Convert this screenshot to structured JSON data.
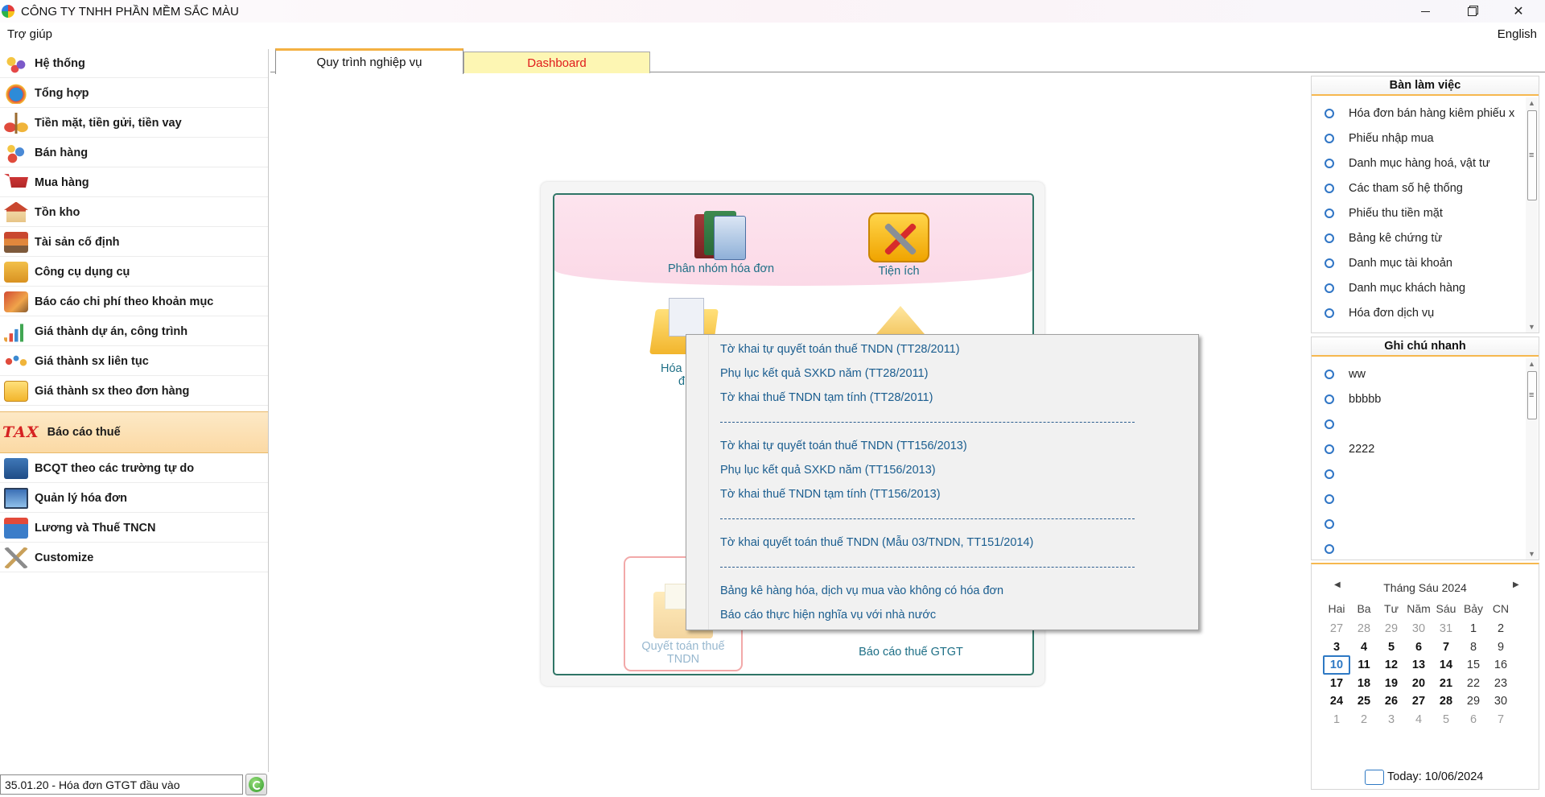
{
  "window": {
    "title": "CÔNG TY TNHH PHẦN MỀM SẮC MÀU"
  },
  "menubar": {
    "help": "Trợ giúp",
    "language": "English"
  },
  "sidebar": {
    "items": [
      {
        "label": "Hệ thống"
      },
      {
        "label": "Tổng hợp"
      },
      {
        "label": "Tiền mặt, tiền gửi, tiền vay"
      },
      {
        "label": "Bán hàng"
      },
      {
        "label": "Mua hàng"
      },
      {
        "label": "Tồn kho"
      },
      {
        "label": "Tài sản cố định"
      },
      {
        "label": "Công cụ dụng cụ"
      },
      {
        "label": "Báo cáo chi phí theo khoản mục"
      },
      {
        "label": "Giá thành dự án, công trình"
      },
      {
        "label": "Giá thành sx liên tục"
      },
      {
        "label": "Giá thành sx theo đơn hàng"
      },
      {
        "label": "Báo cáo thuế",
        "icon_text": "TAX",
        "active": true
      },
      {
        "label": "BCQT theo các trường tự do"
      },
      {
        "label": "Quản lý hóa đơn"
      },
      {
        "label": "Lương và Thuế TNCN"
      },
      {
        "label": "Customize"
      }
    ],
    "search_value": "35.01.20 - Hóa đơn GTGT đầu vào"
  },
  "tabs": [
    {
      "label": "Quy trình nghiệp vụ",
      "active": true
    },
    {
      "label": "Dashboard"
    }
  ],
  "workflow": {
    "group_invoices": "Phân nhóm hóa đơn",
    "utilities": "Tiện ích",
    "partial_left": "Hóa",
    "partial_left2": "đ",
    "cit_settlement_line1": "Quyết toán thuế",
    "cit_settlement_line2": "TNDN",
    "vat_report": "Báo cáo thuế GTGT"
  },
  "context_menu": {
    "items": [
      "Tờ khai tự quyết toán thuế TNDN (TT28/2011)",
      "Phụ lục kết quả SXKD năm (TT28/2011)",
      "Tờ khai thuế TNDN tạm tính (TT28/2011)",
      "Tờ khai tự quyết toán thuế TNDN (TT156/2013)",
      "Phụ lục kết quả SXKD năm (TT156/2013)",
      "Tờ khai thuế TNDN tạm tính (TT156/2013)",
      "Tờ khai quyết toán thuế TNDN (Mẫu 03/TNDN, TT151/2014)",
      "Bảng kê hàng hóa, dịch vụ mua vào không có hóa đơn",
      "Báo cáo thực hiện nghĩa vụ với nhà nước"
    ]
  },
  "workdesk": {
    "title": "Bàn làm việc",
    "items": [
      "Hóa đơn bán hàng kiêm phiếu x",
      "Phiếu nhập mua",
      "Danh mục hàng hoá, vật tư",
      "Các tham số hệ thống",
      "Phiếu thu tiền mặt",
      "Bảng kê chứng từ",
      "Danh mục tài khoản",
      "Danh mục khách hàng",
      "Hóa đơn dịch vụ"
    ]
  },
  "quick_notes": {
    "title": "Ghi chú nhanh",
    "items": [
      "ww",
      "bbbbb",
      "",
      "2222",
      "",
      "",
      "",
      ""
    ]
  },
  "calendar": {
    "title": "Tháng Sáu 2024",
    "days_of_week": [
      "Hai",
      "Ba",
      "Tư",
      "Năm",
      "Sáu",
      "Bảy",
      "CN"
    ],
    "weeks": [
      [
        "27",
        "28",
        "29",
        "30",
        "31",
        "1",
        "2"
      ],
      [
        "3",
        "4",
        "5",
        "6",
        "7",
        "8",
        "9"
      ],
      [
        "10",
        "11",
        "12",
        "13",
        "14",
        "15",
        "16"
      ],
      [
        "17",
        "18",
        "19",
        "20",
        "21",
        "22",
        "23"
      ],
      [
        "24",
        "25",
        "26",
        "27",
        "28",
        "29",
        "30"
      ],
      [
        "1",
        "2",
        "3",
        "4",
        "5",
        "6",
        "7"
      ]
    ],
    "selected_day": "10",
    "today_label": "Today: 10/06/2024"
  }
}
